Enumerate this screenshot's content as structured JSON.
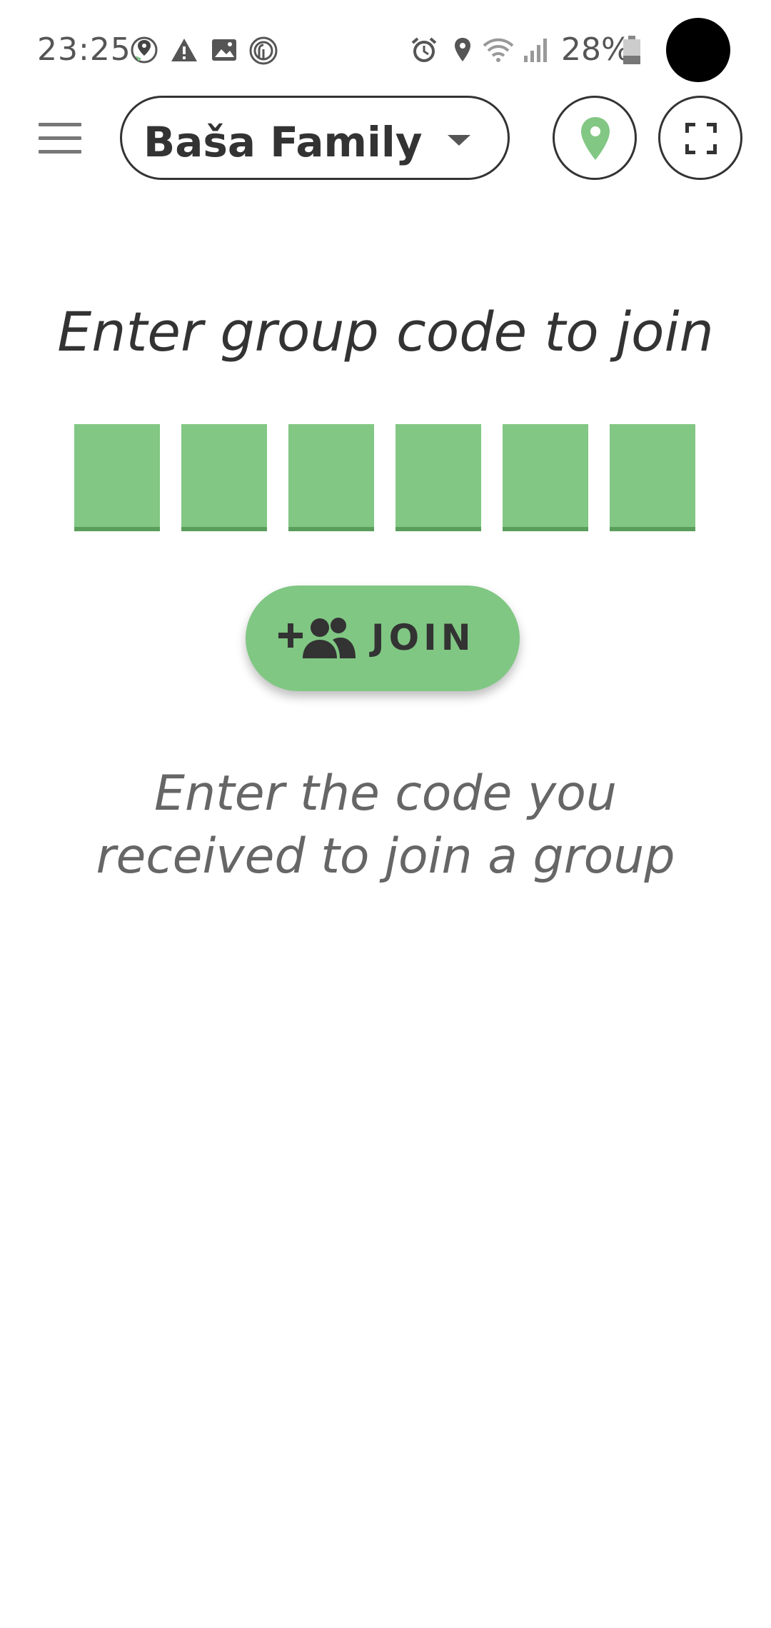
{
  "status_bar": {
    "time": "23:25",
    "battery": "28%",
    "left_icons": [
      "location-sync-icon",
      "warning-icon",
      "image-icon",
      "fingerprint-icon"
    ],
    "right_icons": [
      "alarm-icon",
      "location-icon",
      "wifi-icon",
      "signal-icon",
      "battery-icon"
    ]
  },
  "toolbar": {
    "group_name": "Baša Family",
    "menu_icon": "menu-icon",
    "location_icon": "map-pin-icon",
    "fullscreen_icon": "fullscreen-icon"
  },
  "main": {
    "title": "Enter group code to join",
    "code_cells": [
      "",
      "",
      "",
      "",
      "",
      ""
    ],
    "join_label": "JOIN",
    "hint": "Enter the code you received to join a group"
  },
  "colors": {
    "accent_green": "#82c784",
    "text_dark": "#333333",
    "text_grey": "#666666"
  }
}
